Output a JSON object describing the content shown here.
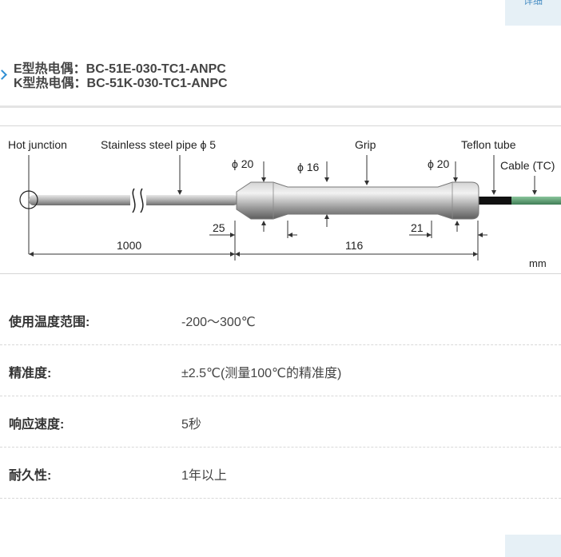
{
  "corner_top": {
    "label": "详细"
  },
  "corner_bottom": {
    "label": ""
  },
  "models": {
    "e_type": "E型热电偶：BC-51E-030-TC1-ANPC",
    "k_type": "K型热电偶：BC-51K-030-TC1-ANPC"
  },
  "diagram": {
    "hot_junction": "Hot junction",
    "pipe": "Stainless steel pipe ϕ 5",
    "grip": "Grip",
    "teflon": "Teflon tube",
    "cable": "Cable (TC)",
    "phi20_left": "ϕ 20",
    "phi16": "ϕ 16",
    "phi20_right": "ϕ 20",
    "dim25": "25",
    "dim21": "21",
    "dim1000": "1000",
    "dim116": "116",
    "unit": "mm",
    "colors": {
      "pipe": "#a8a8a8",
      "cable": "#5e9e74",
      "tube": "#111111"
    }
  },
  "specs": [
    {
      "label": "使用温度范围:",
      "value": "-200～300℃"
    },
    {
      "label": "精准度:",
      "value": "±2.5℃(测量100℃的精准度)"
    },
    {
      "label": "响应速度:",
      "value": "5秒"
    },
    {
      "label": "耐久性:",
      "value": "1年以上"
    }
  ]
}
